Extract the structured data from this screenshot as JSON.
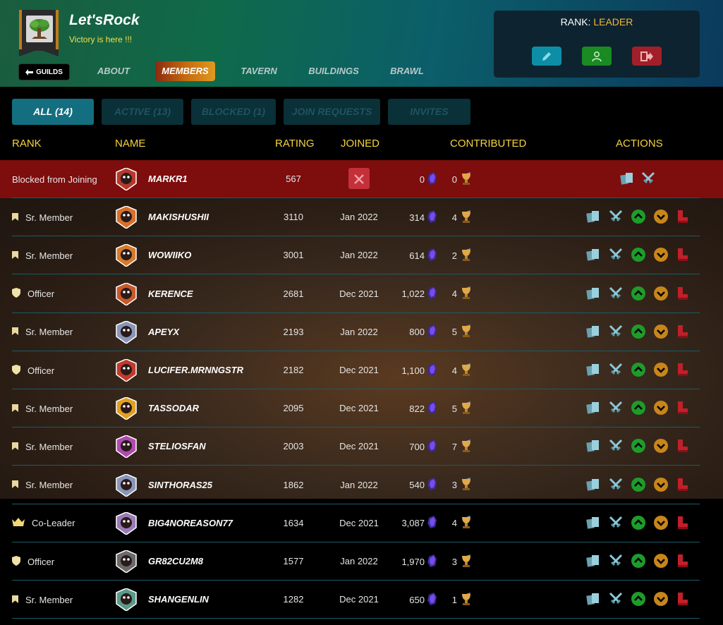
{
  "guild": {
    "name": "Let'sRock",
    "motto": "Victory is here !!!"
  },
  "nav": {
    "back_label": "GUILDS",
    "tabs": [
      {
        "label": "ABOUT",
        "active": false
      },
      {
        "label": "MEMBERS",
        "active": true
      },
      {
        "label": "TAVERN",
        "active": false
      },
      {
        "label": "BUILDINGS",
        "active": false
      },
      {
        "label": "BRAWL",
        "active": false
      }
    ]
  },
  "rank_box": {
    "prefix": "RANK: ",
    "value": "LEADER"
  },
  "filters": [
    {
      "label": "ALL (14)",
      "active": true
    },
    {
      "label": "ACTIVE (13)",
      "active": false
    },
    {
      "label": "BLOCKED (1)",
      "active": false
    },
    {
      "label": "JOIN REQUESTS",
      "active": false
    },
    {
      "label": "INVITES",
      "active": false
    }
  ],
  "table": {
    "headers": {
      "rank": "RANK",
      "name": "NAME",
      "rating": "RATING",
      "joined": "JOINED",
      "contributed": "CONTRIBUTED",
      "actions": "ACTIONS"
    },
    "rows": [
      {
        "rank": "Blocked from Joining",
        "rank_icon": "none",
        "name": "MARKR1",
        "rating": "567",
        "joined": "",
        "joined_icon": "blocked-x-icon",
        "crystals": "0",
        "trophies": "0",
        "blocked": true
      },
      {
        "rank": "Sr. Member",
        "rank_icon": "bookmark-icon",
        "name": "MAKISHUSHII",
        "rating": "3110",
        "joined": "Jan 2022",
        "crystals": "314",
        "trophies": "4",
        "blocked": false
      },
      {
        "rank": "Sr. Member",
        "rank_icon": "bookmark-icon",
        "name": "WOWIIKO",
        "rating": "3001",
        "joined": "Jan 2022",
        "crystals": "614",
        "trophies": "2",
        "blocked": false
      },
      {
        "rank": "Officer",
        "rank_icon": "shield-icon",
        "name": "KERENCE",
        "rating": "2681",
        "joined": "Dec 2021",
        "crystals": "1,022",
        "trophies": "4",
        "blocked": false
      },
      {
        "rank": "Sr. Member",
        "rank_icon": "bookmark-icon",
        "name": "APEYX",
        "rating": "2193",
        "joined": "Jan 2022",
        "crystals": "800",
        "trophies": "5",
        "blocked": false
      },
      {
        "rank": "Officer",
        "rank_icon": "shield-icon",
        "name": "LUCIFER.MRNNGSTR",
        "rating": "2182",
        "joined": "Dec 2021",
        "crystals": "1,100",
        "trophies": "4",
        "blocked": false
      },
      {
        "rank": "Sr. Member",
        "rank_icon": "bookmark-icon",
        "name": "TASSODAR",
        "rating": "2095",
        "joined": "Dec 2021",
        "crystals": "822",
        "trophies": "5",
        "blocked": false
      },
      {
        "rank": "Sr. Member",
        "rank_icon": "bookmark-icon",
        "name": "STELIOSFAN",
        "rating": "2003",
        "joined": "Dec 2021",
        "crystals": "700",
        "trophies": "7",
        "blocked": false
      },
      {
        "rank": "Sr. Member",
        "rank_icon": "bookmark-icon",
        "name": "SINTHORAS25",
        "rating": "1862",
        "joined": "Jan 2022",
        "crystals": "540",
        "trophies": "3",
        "blocked": false
      },
      {
        "rank": "Co-Leader",
        "rank_icon": "crown-icon",
        "name": "BIG4NOREASON77",
        "rating": "1634",
        "joined": "Dec 2021",
        "crystals": "3,087",
        "trophies": "4",
        "blocked": false
      },
      {
        "rank": "Officer",
        "rank_icon": "shield-icon",
        "name": "GR82CU2M8",
        "rating": "1577",
        "joined": "Jan 2022",
        "crystals": "1,970",
        "trophies": "3",
        "blocked": false
      },
      {
        "rank": "Sr. Member",
        "rank_icon": "bookmark-icon",
        "name": "SHANGENLIN",
        "rating": "1282",
        "joined": "Dec 2021",
        "crystals": "650",
        "trophies": "1",
        "blocked": false
      }
    ]
  },
  "colors": {
    "accent": "#f5d43c",
    "blocked_row": "#7e0d0d",
    "tab_active": "#136f80",
    "promote": "#1e9c2a",
    "demote": "#c8861a",
    "kick": "#c0202a"
  }
}
